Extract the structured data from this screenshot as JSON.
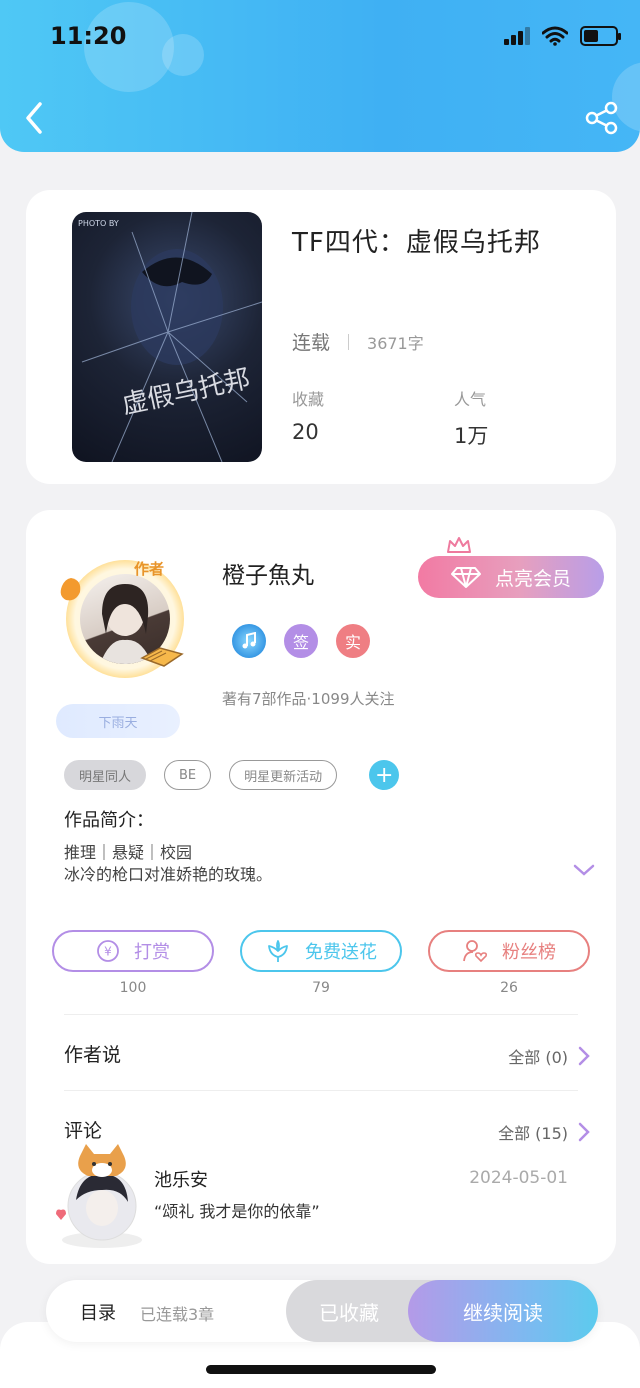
{
  "status_bar": {
    "time": "11:20"
  },
  "colors": {
    "header": "#44b8f4",
    "accent_purple": "#b38ee6",
    "accent_cyan": "#4cc6ec",
    "accent_red": "#e7807f"
  },
  "book": {
    "title": "TF四代：虚假乌托邦",
    "status": "连载",
    "word_count": "3671字",
    "favorites_label": "收藏",
    "favorites_value": "20",
    "popularity_label": "人气",
    "popularity_value": "1万",
    "cover_text": "PHOTO BY",
    "cover_art_text": "虚假乌托邦"
  },
  "author": {
    "tag": "作者",
    "name": "橙子魚丸",
    "vip_button": "点亮会员",
    "badges": [
      {
        "icon": "music-medal-icon",
        "label": "",
        "color": "#3aa6e8"
      },
      {
        "icon": "sign-badge-icon",
        "label": "签",
        "color": "#b38ee6"
      },
      {
        "icon": "real-badge-icon",
        "label": "实",
        "color": "#ef7e83"
      }
    ],
    "stats": "著有7部作品·1099人关注",
    "frame_badge": "下雨天"
  },
  "tags": [
    "明星同人",
    "BE",
    "明星更新活动"
  ],
  "intro": {
    "title": "作品简介：",
    "line1": "推理｜悬疑｜校园",
    "line2": "冰冷的枪口对准娇艳的玫瑰。"
  },
  "actions": [
    {
      "label": "打赏",
      "count": "100",
      "icon": "yen-icon",
      "color": "#b38ee6"
    },
    {
      "label": "免费送花",
      "count": "79",
      "icon": "flower-icon",
      "color": "#4cc6ec"
    },
    {
      "label": "粉丝榜",
      "count": "26",
      "icon": "fan-user-icon",
      "color": "#e7807f"
    }
  ],
  "author_says": {
    "title": "作者说",
    "link": "全部 (0)"
  },
  "comments": {
    "title": "评论",
    "link": "全部 (15)",
    "items": [
      {
        "user": "池乐安",
        "date": "2024-05-01",
        "text": "“颂礼 我才是你的依靠”"
      }
    ]
  },
  "bottom": {
    "toc": "目录",
    "toc_count": "已连载3章",
    "favorited": "已收藏",
    "continue": "继续阅读"
  }
}
